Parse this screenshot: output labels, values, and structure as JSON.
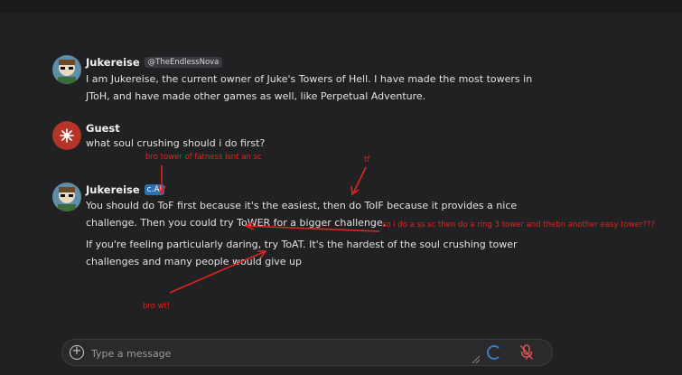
{
  "messages": [
    {
      "author": "Jukereise",
      "handle": "@TheEndlessNova",
      "lines": [
        "I am Jukereise, the current owner of Juke's Towers of Hell. I have made the most towers in",
        "JToH, and have made other games as well, like Perpetual Adventure."
      ]
    },
    {
      "author": "Guest",
      "lines": [
        "what soul crushing should i do first?"
      ]
    },
    {
      "author": "Jukereise",
      "badge": "c.AI",
      "paragraph1": [
        "You should do ToF first because it's the easiest, then do ToIF because it provides a nice",
        "challenge. Then you could try ToWER for a bigger challenge."
      ],
      "paragraph2": [
        "If you're feeling particularly daring, try ToAT. It's the hardest of the soul crushing tower",
        "challenges and many people would give up"
      ]
    }
  ],
  "annotations": {
    "fatness": "bro tower of fatness isnt an sc",
    "tf": "tf",
    "ring": "so i do a ss sc then do a ring 3 tower and thebn another easy tower???",
    "wt": "bro wt!"
  },
  "input": {
    "placeholder": "Type a message"
  },
  "colors": {
    "annotation": "#e0241f",
    "accent": "#2a6fb0",
    "background": "#212124"
  },
  "icons": [
    "add-icon",
    "resize-handle-icon",
    "loading-spinner-icon",
    "microphone-muted-icon"
  ]
}
